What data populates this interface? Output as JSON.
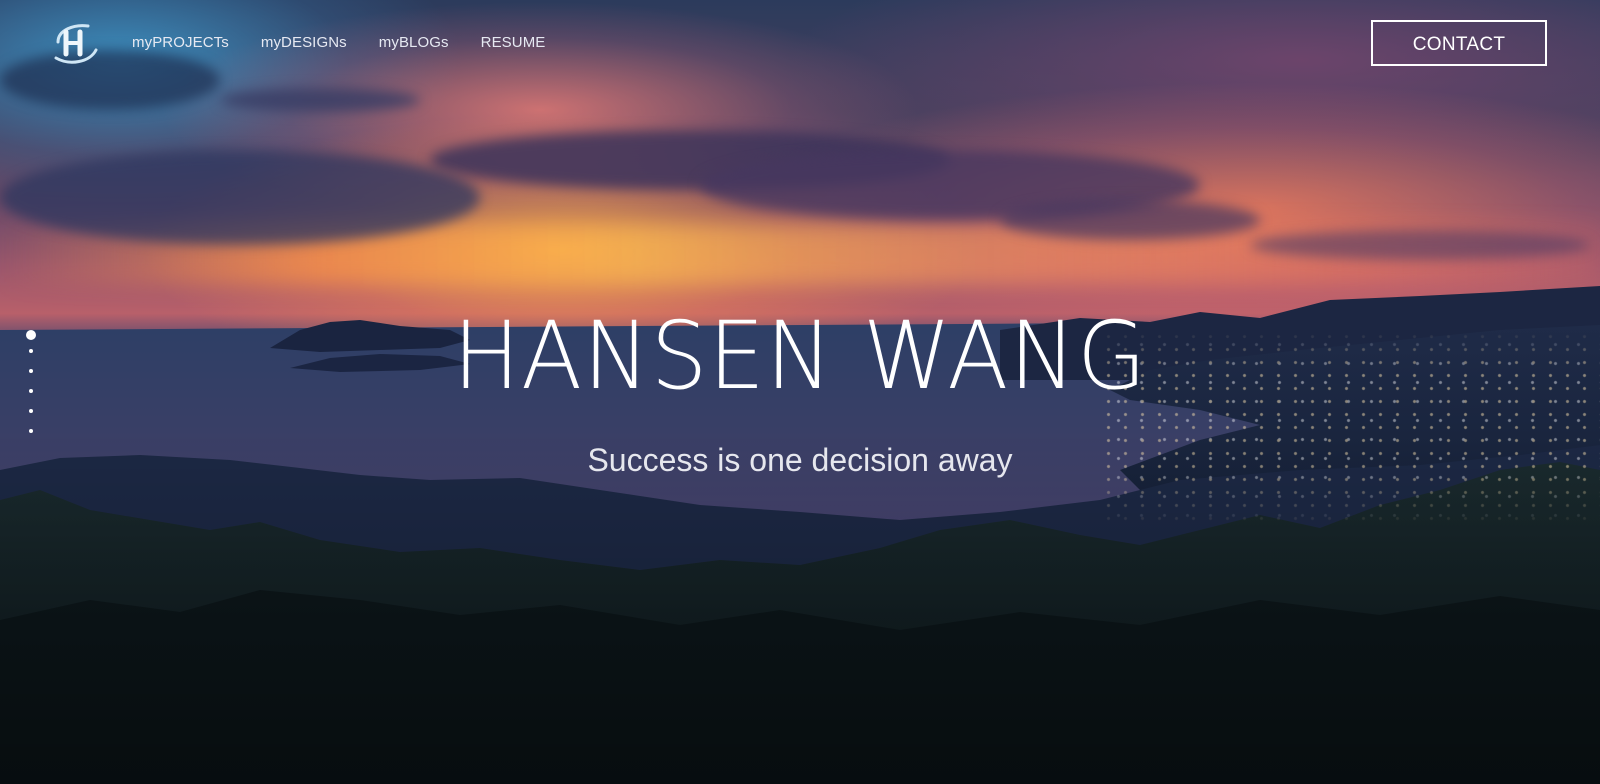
{
  "brand": {
    "logo_icon": "hw-monogram-logo"
  },
  "nav": {
    "items": [
      {
        "label": "myPROJECTs"
      },
      {
        "label": "myDESIGNs"
      },
      {
        "label": "myBLOGs"
      },
      {
        "label": "RESUME"
      }
    ]
  },
  "header": {
    "contact_label": "CONTACT"
  },
  "section_nav": {
    "total": 6,
    "active_index": 0
  },
  "hero": {
    "title": "HANSEN WANG",
    "subtitle": "Success is one decision away"
  },
  "colors": {
    "text": "#ffffff",
    "sky_orange": "#ffb046",
    "sky_blue": "#3c96c8"
  }
}
